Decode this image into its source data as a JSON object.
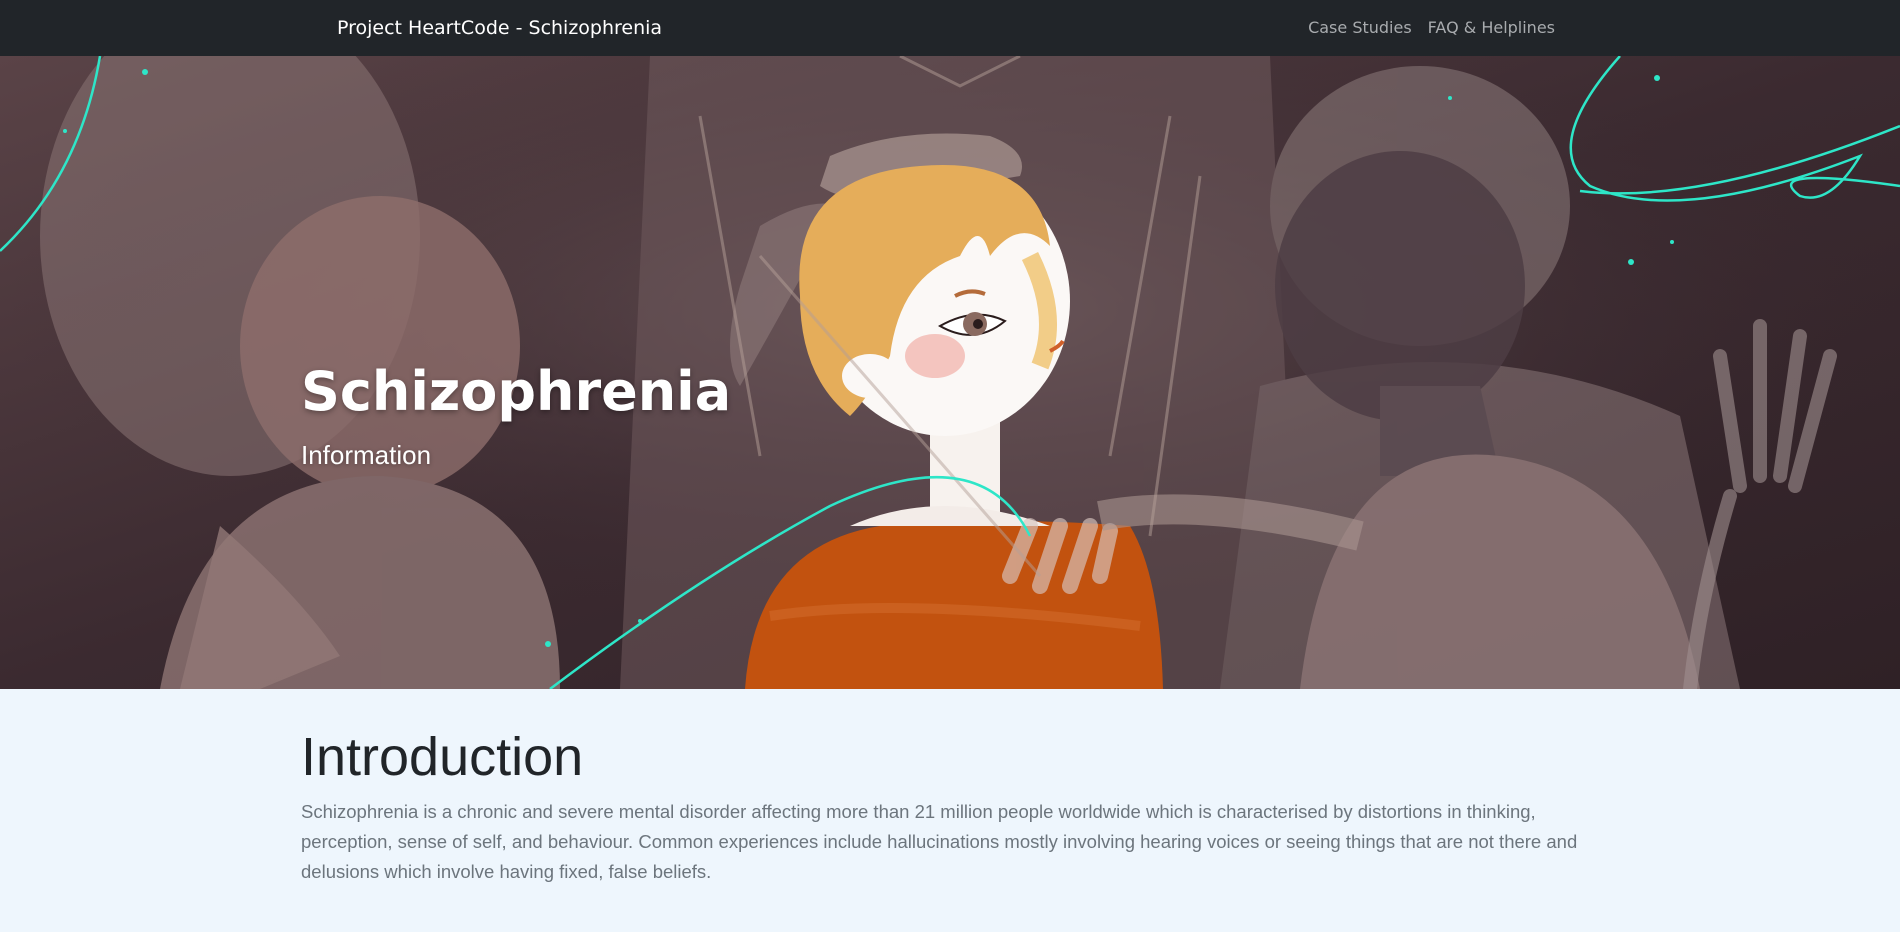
{
  "navbar": {
    "brand": "Project HeartCode - Schizophrenia",
    "links": [
      "Case Studies",
      "FAQ & Helplines"
    ]
  },
  "hero": {
    "title": "Schizophrenia",
    "subtitle": "Information",
    "illustration": "painted-figures-illustration"
  },
  "intro": {
    "heading": "Introduction",
    "body": "Schizophrenia is a chronic and severe mental disorder affecting more than 21 million people worldwide which is characterised by distortions in thinking, perception, sense of self, and behaviour. Common experiences include hallucinations mostly involving hearing voices or seeing things that are not there and delusions which involve having fixed, false beliefs."
  },
  "colors": {
    "navbar": "#212529",
    "content_background": "#eef6fd",
    "accent_line": "#2ee6c8",
    "sweater": "#c2520f"
  }
}
